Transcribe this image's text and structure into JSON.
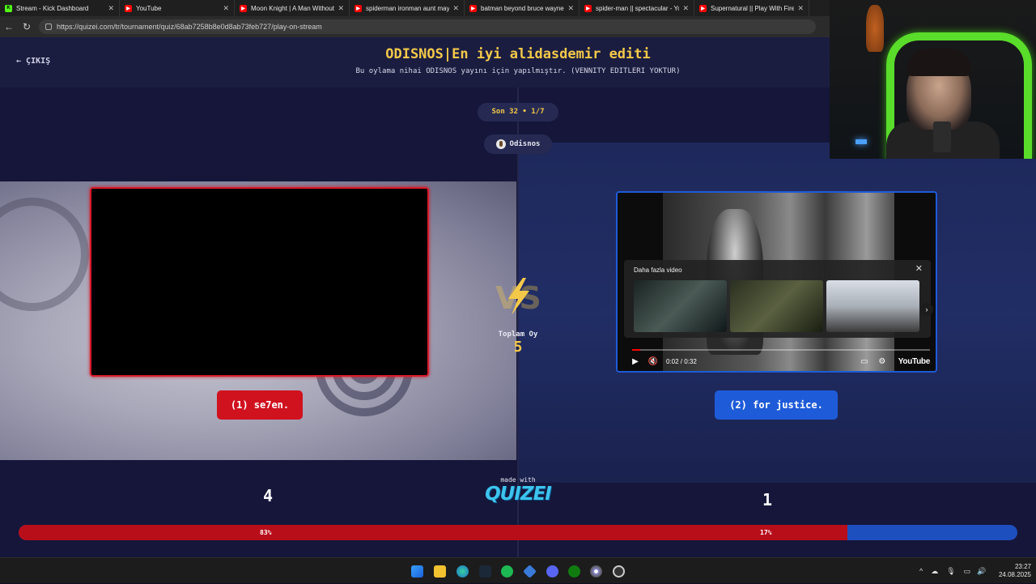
{
  "browser": {
    "tabs": [
      {
        "title": "Stream - Kick Dashboard",
        "favicon": "kick"
      },
      {
        "title": "YouTube",
        "favicon": "youtube"
      },
      {
        "title": "Moon Knight | A Man Without",
        "favicon": "youtube"
      },
      {
        "title": "spiderman ironman aunt may",
        "favicon": "youtube"
      },
      {
        "title": "batman beyond bruce wayne",
        "favicon": "youtube"
      },
      {
        "title": "spider-man || spectacular - You",
        "favicon": "youtube"
      },
      {
        "title": "Supernatural || Play With Fire",
        "favicon": "youtube"
      }
    ],
    "url": "https://quizei.com/tr/tournament/quiz/68ab7258b8e0d8ab73feb727/play-on-stream"
  },
  "header": {
    "exit_label": "ÇIKIŞ",
    "title": "ODISNOS|En iyi alidasdemir editi",
    "subtitle": "Bu oylama nihai ODISNOS yayını için yapılmıştır. (VENNITY EDITLERI YOKTUR)"
  },
  "round": {
    "label": "Son 32 • 1/7"
  },
  "author": {
    "name": "Odisnos"
  },
  "vs": {
    "label": "VS"
  },
  "total": {
    "label": "Toplam Oy",
    "value": "5"
  },
  "youtube_player": {
    "more_videos_label": "Daha fazla video",
    "time": "0:02 / 0:32",
    "logo": "YouTube"
  },
  "options": [
    {
      "label": "(1) se7en.",
      "votes": "4",
      "percent": "83%",
      "color": "#d0121f"
    },
    {
      "label": "(2) for justice.",
      "votes": "1",
      "percent": "17%",
      "color": "#1e5bd8"
    }
  ],
  "progress": {
    "red_fraction": 0.83
  },
  "footer": {
    "made_with": "made with",
    "brand": "QUIZEI"
  },
  "taskbar": {
    "time": "23:27",
    "date": "24.08.2025"
  },
  "colors": {
    "accent": "#f4c94a",
    "red": "#d0121f",
    "blue": "#1e5bd8",
    "brand": "#3cc4ee"
  }
}
